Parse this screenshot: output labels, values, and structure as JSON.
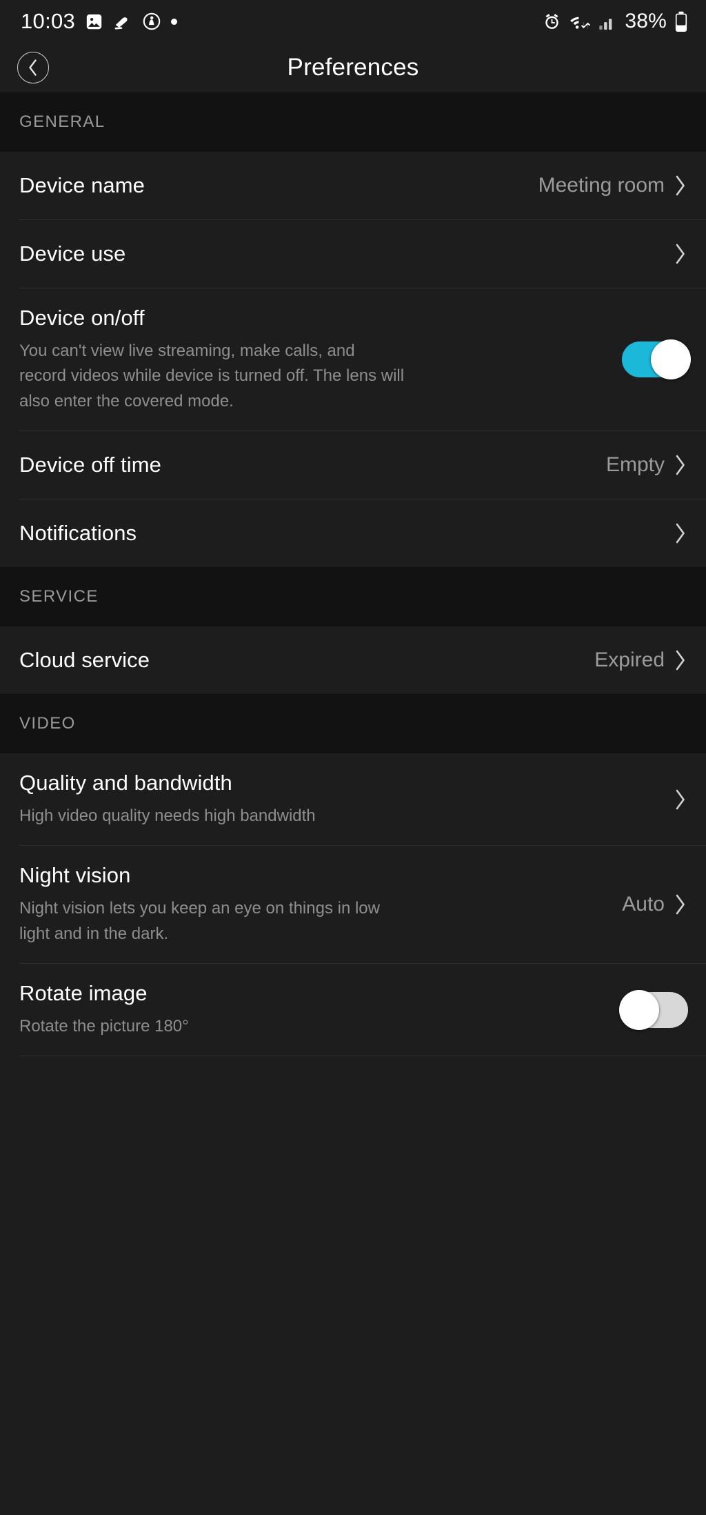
{
  "status_bar": {
    "time": "10:03",
    "battery_percent": "38%",
    "battery_level": 38,
    "left_icons": [
      "photo-icon",
      "silent-mode-icon",
      "do-not-disturb-icon",
      "dot-indicator-icon"
    ],
    "right_icons": [
      "alarm-icon",
      "wifi-icon",
      "signal-icon",
      "battery-icon"
    ]
  },
  "header": {
    "title": "Preferences",
    "back_label": "Back"
  },
  "sections": [
    {
      "id": "general",
      "label": "GENERAL",
      "rows": [
        {
          "id": "device-name",
          "title": "Device name",
          "desc": "",
          "value": "Meeting room",
          "control": "chevron"
        },
        {
          "id": "device-use",
          "title": "Device use",
          "desc": "",
          "value": "",
          "control": "chevron"
        },
        {
          "id": "device-on-off",
          "title": "Device on/off",
          "desc": "You can't view live streaming, make calls, and record videos while device is turned off. The lens will also enter the covered mode.",
          "value": "",
          "control": "toggle",
          "toggle_state": "on"
        },
        {
          "id": "device-off-time",
          "title": "Device off time",
          "desc": "",
          "value": "Empty",
          "control": "chevron"
        },
        {
          "id": "notifications",
          "title": "Notifications",
          "desc": "",
          "value": "",
          "control": "chevron"
        }
      ]
    },
    {
      "id": "service",
      "label": "SERVICE",
      "rows": [
        {
          "id": "cloud-service",
          "title": "Cloud service",
          "desc": "",
          "value": "Expired",
          "control": "chevron"
        }
      ]
    },
    {
      "id": "video",
      "label": "VIDEO",
      "rows": [
        {
          "id": "quality-bandwidth",
          "title": "Quality and bandwidth",
          "desc": "High video quality needs high bandwidth",
          "value": "",
          "control": "chevron"
        },
        {
          "id": "night-vision",
          "title": "Night vision",
          "desc": "Night vision lets you keep an eye on things in low light and in the dark.",
          "value": "Auto",
          "control": "chevron"
        },
        {
          "id": "rotate-image",
          "title": "Rotate image",
          "desc": "Rotate the picture 180°",
          "value": "",
          "control": "toggle",
          "toggle_state": "off"
        }
      ]
    }
  ],
  "colors": {
    "background": "#1d1d1d",
    "section_header_bg": "#121212",
    "toggle_on": "#1cb8d9",
    "toggle_off": "#d8d8d8",
    "primary_text": "#ffffff",
    "secondary_text": "#8e8e8e",
    "divider": "#2e2e2e"
  }
}
